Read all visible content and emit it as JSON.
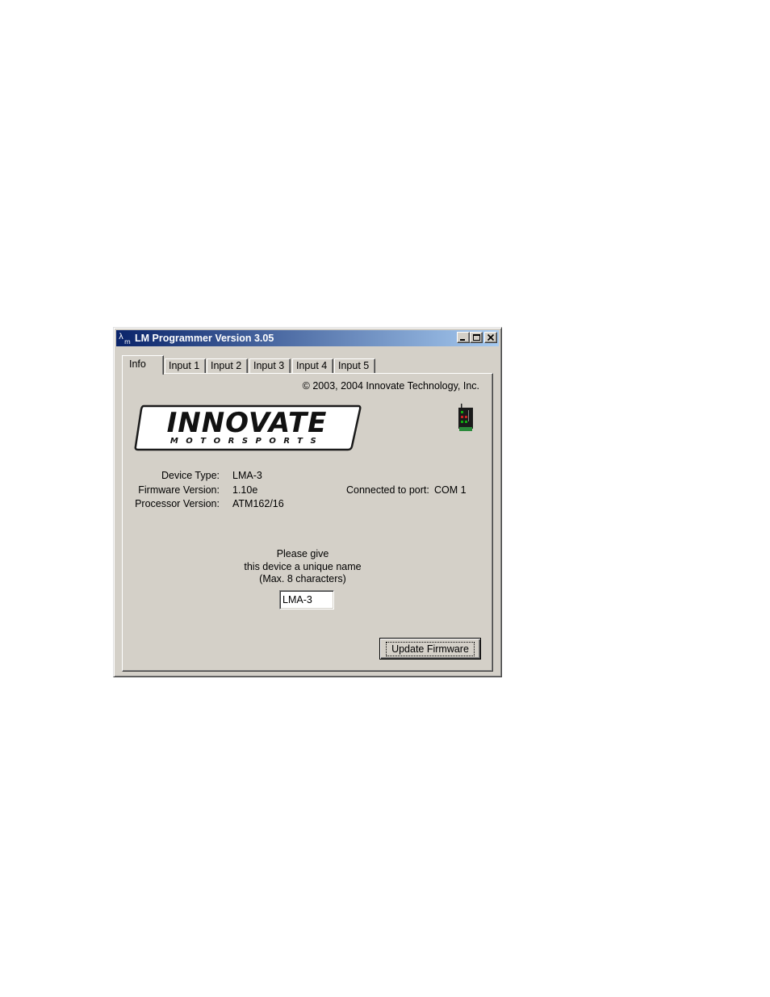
{
  "window": {
    "title": "LM Programmer Version 3.05",
    "title_bar_color": "#0a246a",
    "face_color": "#d4d0c8"
  },
  "tabs": [
    {
      "label": "Info",
      "active": true
    },
    {
      "label": "Input 1",
      "active": false
    },
    {
      "label": "Input 2",
      "active": false
    },
    {
      "label": "Input 3",
      "active": false
    },
    {
      "label": "Input 4",
      "active": false
    },
    {
      "label": "Input 5",
      "active": false
    }
  ],
  "info": {
    "copyright": "© 2003, 2004 Innovate Technology, Inc.",
    "logo_main": "INNOVATE",
    "logo_sub": "MOTORSPORTS",
    "device_type_label": "Device Type:",
    "device_type_value": "LMA-3",
    "firmware_version_label": "Firmware Version:",
    "firmware_version_value": "1.10e",
    "processor_version_label": "Processor Version:",
    "processor_version_value": "ATM162/16",
    "connected_port_label": "Connected to port:",
    "connected_port_value": "COM 1",
    "prompt_line1": "Please give",
    "prompt_line2": "this device a unique name",
    "prompt_line3": "(Max. 8 characters)",
    "device_name_value": "LMA-3",
    "update_firmware_label": "Update Firmware"
  },
  "icons": {
    "app": "lambda-m-icon",
    "device": "lma3-device-icon",
    "minimize": "minimize-icon",
    "maximize": "maximize-icon",
    "close": "close-icon"
  }
}
